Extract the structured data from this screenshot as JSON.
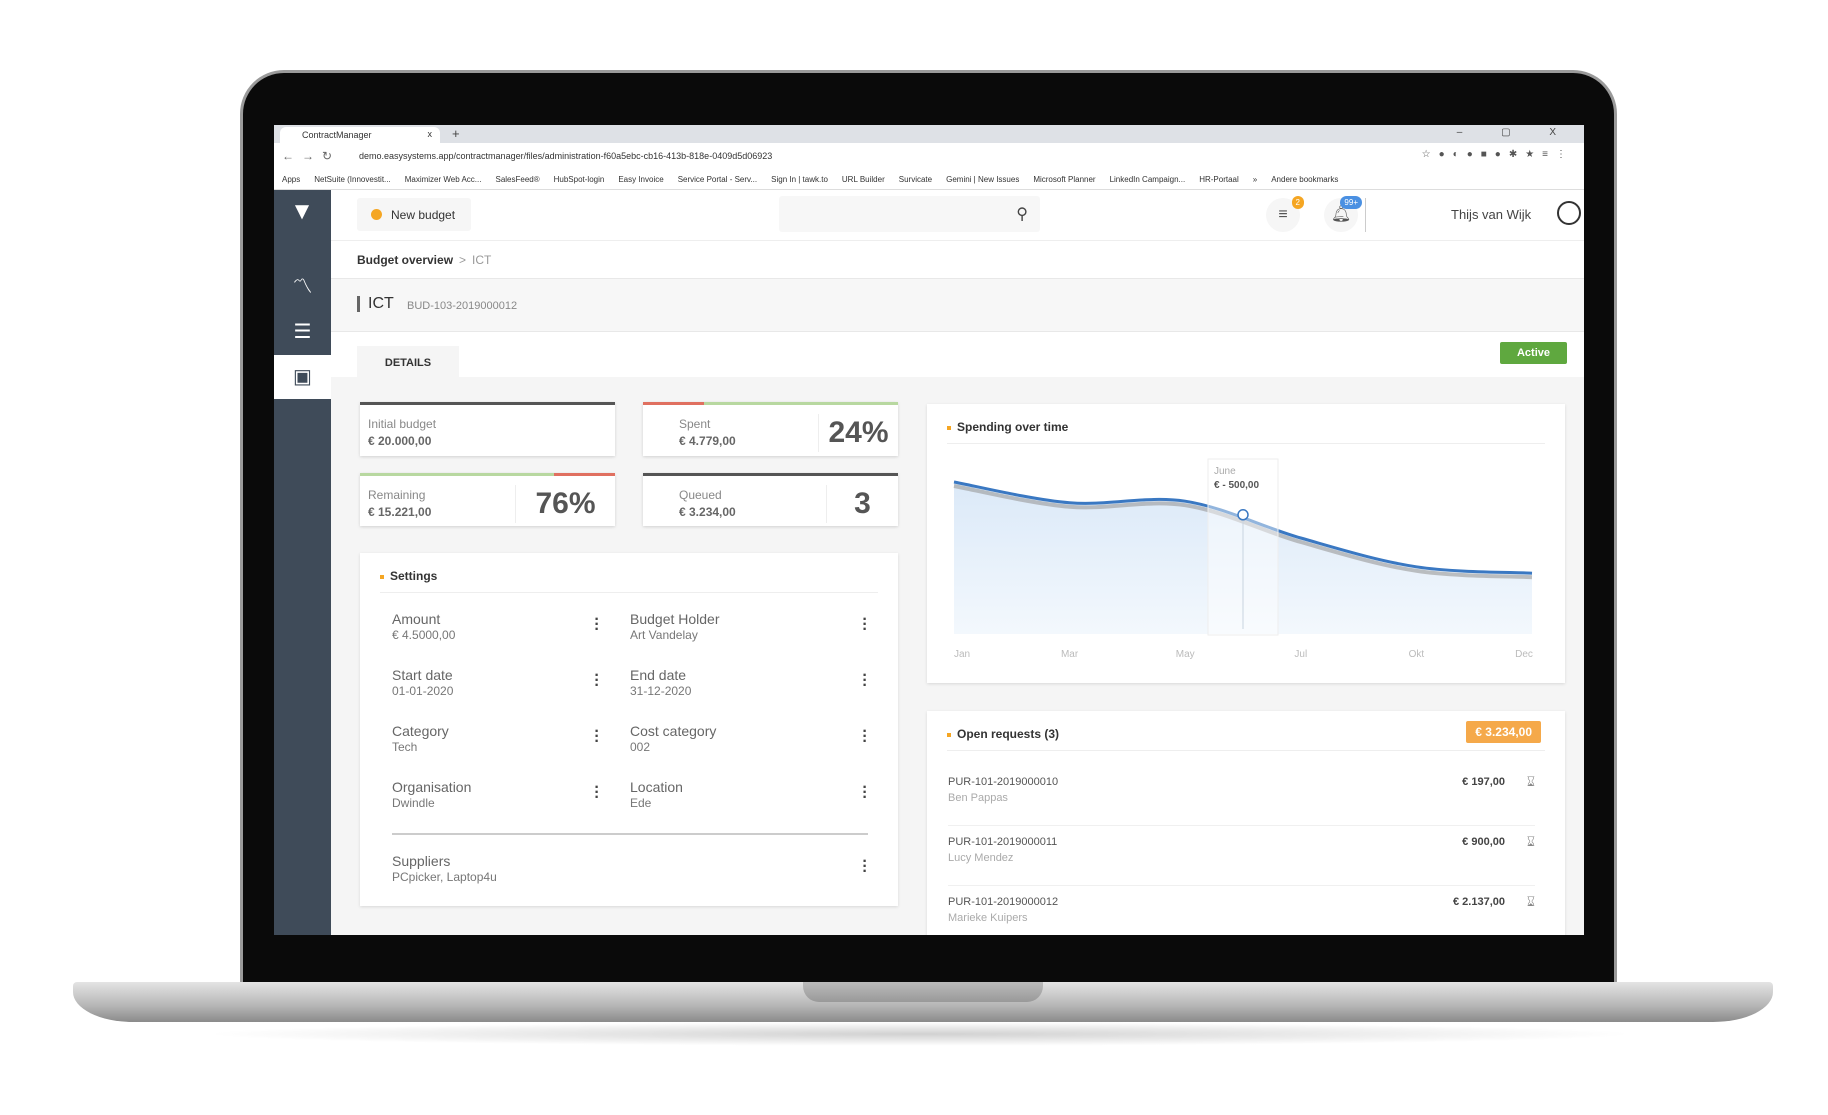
{
  "browser": {
    "tab_title": "ContractManager",
    "tab_close": "x",
    "new_tab": "+",
    "window_controls": "– ▢ X",
    "url": "demo.easysystems.app/contractmanager/files/administration-f60a5ebc-cb16-413b-818e-0409d5d06923",
    "bookmarks": [
      "Apps",
      "NetSuite (Innovestit...",
      "Maximizer Web Acc...",
      "SalesFeed®",
      "HubSpot-login",
      "Easy Invoice",
      "Service Portal - Serv...",
      "Sign In | tawk.to",
      "URL Builder",
      "Survicate",
      "Gemini | New Issues",
      "Microsoft Planner",
      "LinkedIn Campaign...",
      "HR-Portaal",
      "»",
      "Andere bookmarks"
    ]
  },
  "sidebar": {
    "items": [
      {
        "icon": "trend-icon",
        "glyph": "〽"
      },
      {
        "icon": "list-icon",
        "glyph": "☰"
      },
      {
        "icon": "wallet-icon",
        "glyph": "▣",
        "active": true
      }
    ]
  },
  "header": {
    "new_budget": "New budget",
    "search_placeholder": "",
    "tasks_badge": "2",
    "notifications_badge": "99+",
    "user_name": "Thijs van Wijk"
  },
  "breadcrumb": {
    "parent": "Budget overview",
    "separator": ">",
    "current": "ICT"
  },
  "title": {
    "name": "ICT",
    "code": "BUD-103-2019000012"
  },
  "tabs": {
    "details": "DETAILS",
    "status": "Active"
  },
  "cards": {
    "initial": {
      "label": "Initial budget",
      "value": "€ 20.000,00"
    },
    "spent": {
      "label": "Spent",
      "value": "€ 4.779,00",
      "percent": "24%",
      "fraction": 0.24
    },
    "remaining": {
      "label": "Remaining",
      "value": "€ 15.221,00",
      "percent": "76%",
      "fraction": 0.76
    },
    "queued": {
      "label": "Queued",
      "value": "€ 3.234,00",
      "count": "3"
    }
  },
  "settings": {
    "title": "Settings",
    "items": [
      {
        "label": "Amount",
        "value": "€ 4.5000,00"
      },
      {
        "label": "Budget Holder",
        "value": "Art Vandelay"
      },
      {
        "label": "Start date",
        "value": "01-01-2020"
      },
      {
        "label": "End date",
        "value": "31-12-2020"
      },
      {
        "label": "Category",
        "value": "Tech"
      },
      {
        "label": "Cost category",
        "value": "002"
      },
      {
        "label": "Organisation",
        "value": "Dwindle"
      },
      {
        "label": "Location",
        "value": "Ede"
      }
    ],
    "suppliers": {
      "label": "Suppliers",
      "value": "PCpicker, Laptop4u"
    }
  },
  "chart_data": {
    "type": "area",
    "title": "Spending over time",
    "categories": [
      "Jan",
      "Mar",
      "May",
      "Jul",
      "Okt",
      "Dec"
    ],
    "values": [
      95,
      82,
      83,
      60,
      42,
      38
    ],
    "ylim": [
      0,
      100
    ],
    "grid": false,
    "tooltip": {
      "label": "June",
      "value": "€ - 500,00"
    },
    "colors": {
      "line": "#3a78c2",
      "fill": "#dbe9f8"
    }
  },
  "requests": {
    "title": "Open requests (3)",
    "total": "€ 3.234,00",
    "items": [
      {
        "id": "PUR-101-2019000010",
        "name": "Ben Pappas",
        "amount": "€ 197,00"
      },
      {
        "id": "PUR-101-2019000011",
        "name": "Lucy Mendez",
        "amount": "€ 900,00"
      },
      {
        "id": "PUR-101-2019000012",
        "name": "Marieke Kuipers",
        "amount": "€ 2.137,00"
      }
    ]
  },
  "colors": {
    "sidebar": "#3f4b59",
    "accent": "#f5a623",
    "active": "#5fa83f",
    "red": "#e07060",
    "green": "#b8d8a0"
  }
}
